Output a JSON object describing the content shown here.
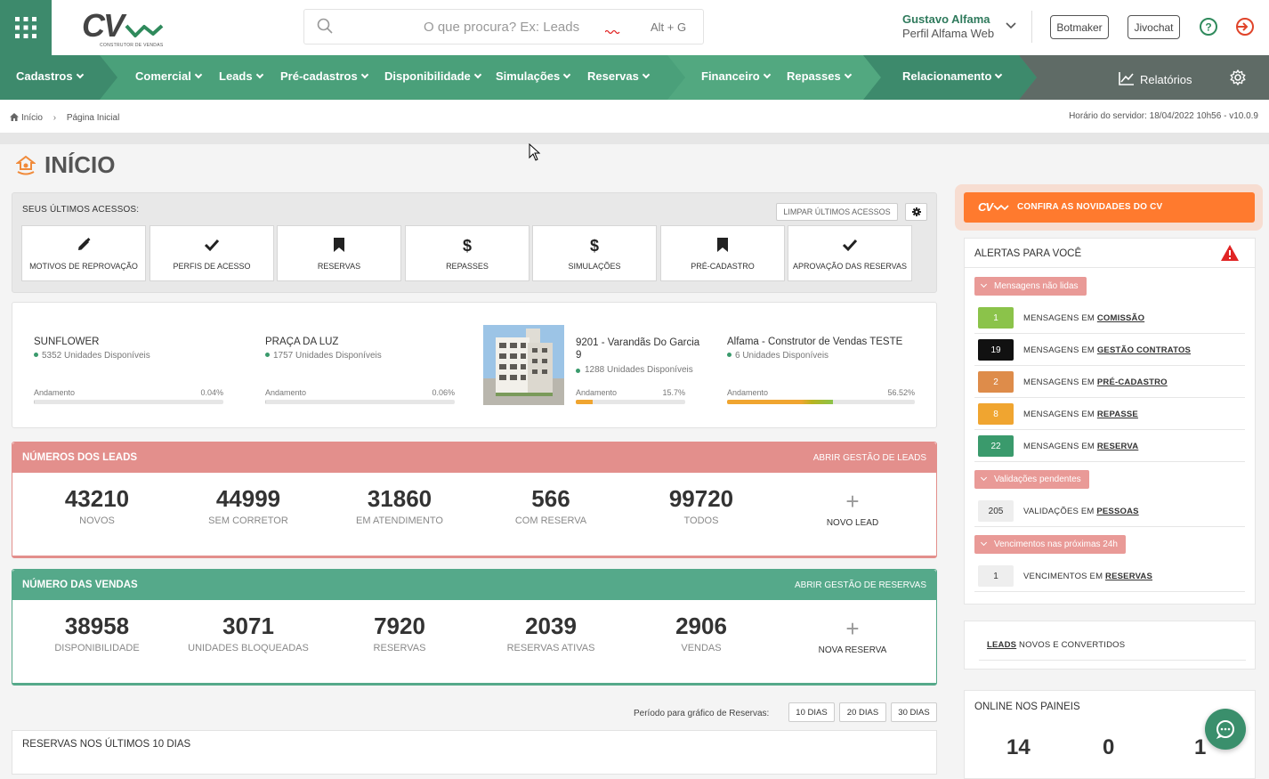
{
  "header": {
    "logo_text": "CV",
    "logo_subtitle": "CONSTRUTOR DE VENDAS",
    "search_placeholder": "O que procura? Ex: Leads",
    "search_shortcut": "Alt + G",
    "user_name": "Gustavo Alfama",
    "user_profile": "Perfil Alfama Web",
    "btn_botmaker": "Botmaker",
    "btn_jivochat": "Jivochat",
    "icons": {
      "grid": "apps-grid-icon",
      "search": "search-icon",
      "help": "help-circle-icon",
      "logout": "logout-icon"
    }
  },
  "nav": {
    "items": [
      "Cadastros",
      "Comercial",
      "Leads",
      "Pré-cadastros",
      "Disponibilidade",
      "Simulações",
      "Reservas",
      "Financeiro",
      "Repasses",
      "Relacionamento"
    ],
    "reports": "Relatórios",
    "colors": {
      "green_dark": "#3d8a6c",
      "green": "#4aa07a",
      "green_mid": "#52a880",
      "gray": "#5f6b66"
    }
  },
  "breadcrumb": {
    "home": "Início",
    "current": "Página Inicial",
    "server_time": "Horário do servidor: 18/04/2022 10h56 - v10.0.9"
  },
  "page_title": "INÍCIO",
  "recent": {
    "label": "SEUS ÚLTIMOS ACESSOS:",
    "clear": "LIMPAR ÚLTIMOS ACESSOS",
    "tiles": [
      {
        "icon": "✎",
        "label": "MOTIVOS DE REPROVAÇÃO"
      },
      {
        "icon": "✔",
        "label": "PERFIS DE ACESSO"
      },
      {
        "icon": "bookmark",
        "label": "RESERVAS"
      },
      {
        "icon": "$",
        "label": "REPASSES"
      },
      {
        "icon": "$",
        "label": "SIMULAÇÕES"
      },
      {
        "icon": "bookmark",
        "label": "PRÉ-CADASTRO"
      },
      {
        "icon": "✔",
        "label": "APROVAÇÃO DAS RESERVAS"
      }
    ]
  },
  "enterprises": [
    {
      "name": "SUNFLOWER",
      "units": "5352 Unidades Disponíveis",
      "progress_label": "Andamento",
      "progress": "0.04%",
      "progress_value": 0.04
    },
    {
      "name": "PRAÇA DA LUZ",
      "units": "1757 Unidades Disponíveis",
      "progress_label": "Andamento",
      "progress": "0.06%",
      "progress_value": 0.06
    },
    {
      "name": "9201 - Varandãs Do Garcia 9",
      "units": "1288 Unidades Disponíveis",
      "progress_label": "Andamento",
      "progress": "15.7%",
      "progress_value": 15.7
    },
    {
      "name": "Alfama - Construtor de Vendas TESTE",
      "units": "6 Unidades Disponíveis",
      "progress_label": "Andamento",
      "progress": "56.52%",
      "progress_value": 56.52
    }
  ],
  "leads_panel": {
    "title": "NÚMEROS DOS LEADS",
    "action": "ABRIR GESTÃO DE LEADS",
    "color": "#e38f8c",
    "stats": [
      {
        "value": "43210",
        "label": "NOVOS"
      },
      {
        "value": "44999",
        "label": "SEM CORRETOR"
      },
      {
        "value": "31860",
        "label": "EM ATENDIMENTO"
      },
      {
        "value": "566",
        "label": "COM RESERVA"
      },
      {
        "value": "99720",
        "label": "TODOS"
      }
    ],
    "add_label": "NOVO LEAD"
  },
  "sales_panel": {
    "title": "NÚMERO DAS VENDAS",
    "action": "ABRIR GESTÃO DE RESERVAS",
    "color": "#55a98a",
    "stats": [
      {
        "value": "38958",
        "label": "DISPONIBILIDADE"
      },
      {
        "value": "3071",
        "label": "UNIDADES BLOQUEADAS"
      },
      {
        "value": "7920",
        "label": "RESERVAS"
      },
      {
        "value": "2039",
        "label": "RESERVAS ATIVAS"
      },
      {
        "value": "2906",
        "label": "VENDAS"
      }
    ],
    "add_label": "NOVA RESERVA"
  },
  "period": {
    "label": "Período para gráfico de Reservas:",
    "options": [
      "10 DIAS",
      "20 DIAS",
      "30 DIAS"
    ]
  },
  "reservations_title": "RESERVAS NOS ÚLTIMOS 10 DIAS",
  "news": {
    "logo": "CV",
    "text": "CONFIRA AS NOVIDADES DO CV"
  },
  "alerts": {
    "title": "ALERTAS PARA VOCÊ",
    "groups": [
      {
        "tag": "Mensagens não lidas",
        "rows": [
          {
            "count": "1",
            "prefix": "MENSAGENS EM ",
            "link": "COMISSÃO",
            "color": "#8bc34a"
          },
          {
            "count": "19",
            "prefix": "MENSAGENS EM ",
            "link": "GESTÃO CONTRATOS",
            "color": "#111111"
          },
          {
            "count": "2",
            "prefix": "MENSAGENS EM ",
            "link": "PRÉ-CADASTRO",
            "color": "#de8c4a"
          },
          {
            "count": "8",
            "prefix": "MENSAGENS EM ",
            "link": "REPASSE",
            "color": "#f0a530"
          },
          {
            "count": "22",
            "prefix": "MENSAGENS EM ",
            "link": "RESERVA",
            "color": "#3a9a6c"
          }
        ]
      },
      {
        "tag": "Validações pendentes",
        "rows": [
          {
            "count": "205",
            "prefix": "VALIDAÇÕES EM ",
            "link": "PESSOAS",
            "color": "#eeeeee"
          }
        ]
      },
      {
        "tag": "Vencimentos nas próximas 24h",
        "rows": [
          {
            "count": "1",
            "prefix": "VENCIMENTOS EM ",
            "link": "RESERVAS",
            "color": "#eeeeee"
          }
        ]
      }
    ]
  },
  "leads_converted": {
    "link": "LEADS",
    "text": " NOVOS E CONVERTIDOS"
  },
  "online": {
    "title": "ONLINE NOS PAINEIS",
    "values": [
      "14",
      "0",
      "1"
    ]
  }
}
